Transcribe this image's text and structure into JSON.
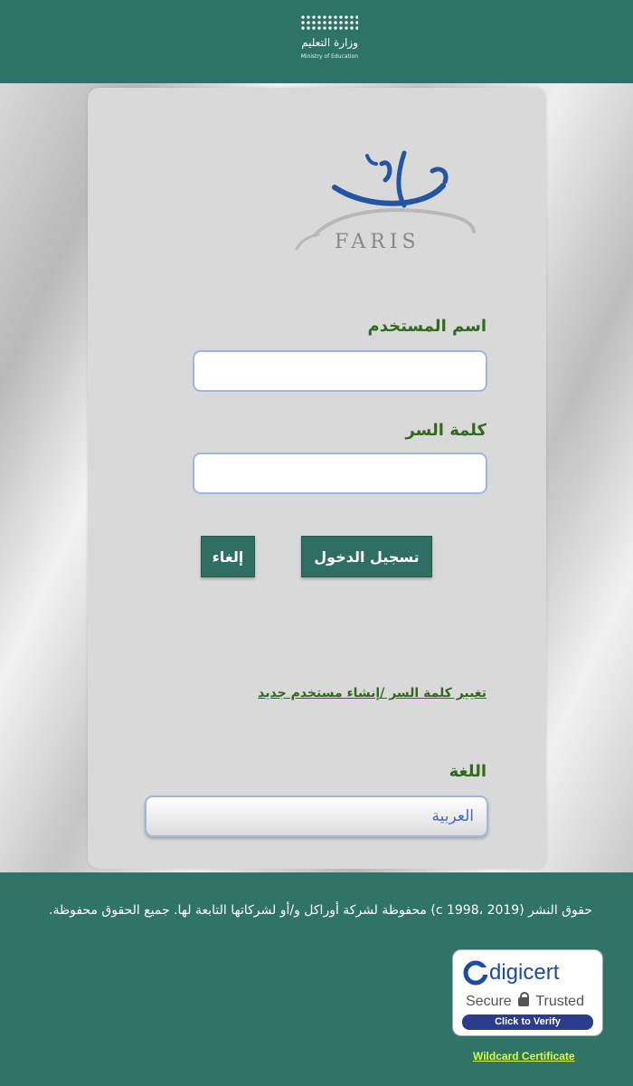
{
  "header": {
    "ministry_ar": "وزارة التعليم",
    "ministry_en": "Ministry of Education"
  },
  "logo": {
    "wordmark": "FARIS"
  },
  "form": {
    "username_label": "اسم المستخدم",
    "username_value": "",
    "password_label": "كلمة السر",
    "password_value": "",
    "login_button": "تسجيل الدخول",
    "cancel_button": "إلغاء",
    "change_password_link": "تغيير كلمة السر /إنشاء مستخدم جديد"
  },
  "language": {
    "label": "اللغة",
    "selected": "العربية"
  },
  "footer": {
    "copyright": "حقوق النشر (c 1998، 2019) محفوظة لشركة أوراكل و/أو لشركاتها التابعة لها. جميع الحقوق محفوظة.",
    "badge_brand": "digicert",
    "badge_secure": "Secure",
    "badge_trusted": "Trusted",
    "badge_verify": "Click to Verify",
    "wildcard_link": "Wildcard Certificate"
  },
  "colors": {
    "header_green": "#2e7466",
    "button_green": "#2f6f63",
    "label_green": "#2f6a1d",
    "link_blue": "#4b67c8"
  }
}
